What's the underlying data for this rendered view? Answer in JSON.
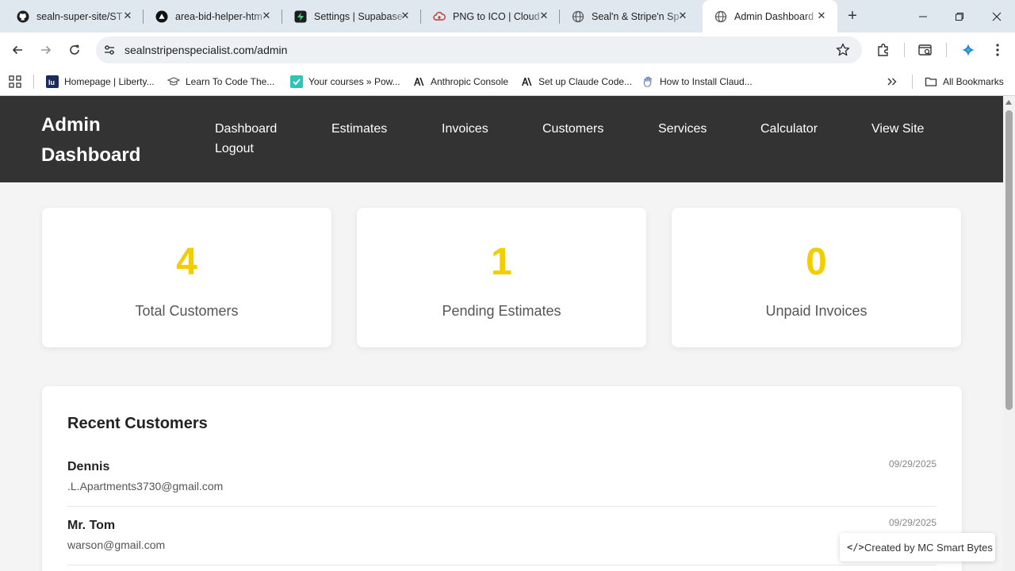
{
  "browser": {
    "tabs": [
      {
        "title": "sealn-super-site/ST",
        "icon": "github-icon",
        "active": false
      },
      {
        "title": "area-bid-helper-htm",
        "icon": "vercel-icon",
        "active": false
      },
      {
        "title": "Settings | Supabase",
        "icon": "supabase-icon",
        "active": false
      },
      {
        "title": "PNG to ICO | Cloud",
        "icon": "cloudconvert-icon",
        "active": false
      },
      {
        "title": "Seal'n & Stripe'n Sp",
        "icon": "globe-icon",
        "active": false
      },
      {
        "title": "Admin Dashboard",
        "icon": "globe-icon",
        "active": true
      }
    ],
    "url": "sealnstripenspecialist.com/admin",
    "bookmarks": [
      {
        "label": "Homepage | Liberty...",
        "icon": "liberty-icon"
      },
      {
        "label": "Learn To Code The...",
        "icon": "graduation-cap-icon"
      },
      {
        "label": "Your courses » Pow...",
        "icon": "courses-icon"
      },
      {
        "label": "Anthropic Console",
        "icon": "anthropic-icon"
      },
      {
        "label": "Set up Claude Code...",
        "icon": "anthropic-icon"
      },
      {
        "label": "How to Install Claud...",
        "icon": "hand-icon"
      }
    ],
    "all_bookmarks_label": "All Bookmarks"
  },
  "site": {
    "brand": "Admin Dashboard",
    "nav": [
      "Dashboard",
      "Estimates",
      "Invoices",
      "Customers",
      "Services",
      "Calculator",
      "View Site",
      "Logout"
    ],
    "stats": [
      {
        "value": "4",
        "label": "Total Customers"
      },
      {
        "value": "1",
        "label": "Pending Estimates"
      },
      {
        "value": "0",
        "label": "Unpaid Invoices"
      }
    ],
    "recent_title": "Recent Customers",
    "customers": [
      {
        "name": "Dennis",
        "email": ".L.Apartments3730@gmail.com",
        "date": "09/29/2025"
      },
      {
        "name": "Mr. Tom",
        "email": "warson@gmail.com",
        "date": "09/29/2025"
      }
    ],
    "credit": "Created by MC Smart Bytes"
  },
  "colors": {
    "header_bg": "#333333",
    "accent_yellow": "#f2cd00",
    "page_bg": "#f4f4f4"
  }
}
